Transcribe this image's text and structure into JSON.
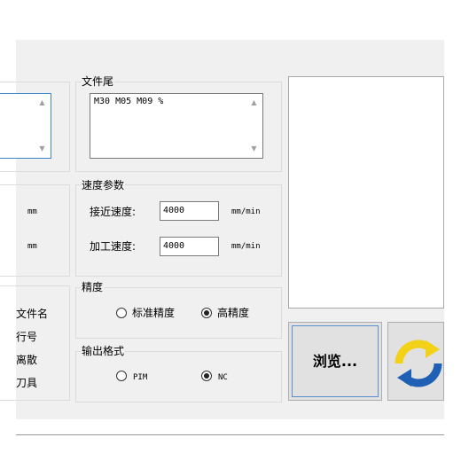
{
  "left_partial": {
    "units": [
      "mm",
      "mm"
    ],
    "options": [
      "文件名",
      "行号",
      "离散",
      "刀具"
    ]
  },
  "file_tail": {
    "legend": "文件尾",
    "content": "M30 M05 M09 %"
  },
  "speed_params": {
    "legend": "速度参数",
    "approach": {
      "label": "接近速度:",
      "value": "4000",
      "unit": "mm/min"
    },
    "machining": {
      "label": "加工速度:",
      "value": "4000",
      "unit": "mm/min"
    }
  },
  "precision": {
    "legend": "精度",
    "options": [
      {
        "label": "标准精度",
        "selected": false
      },
      {
        "label": "高精度",
        "selected": true
      }
    ]
  },
  "output_format": {
    "legend": "输出格式",
    "options": [
      {
        "label": "PIM",
        "selected": false
      },
      {
        "label": "NC",
        "selected": true
      }
    ]
  },
  "browse_button": {
    "label": "浏览..."
  },
  "refresh_button": {
    "icon": "refresh-icon"
  },
  "colors": {
    "refresh_yellow": "#f2d116",
    "refresh_blue": "#1f5fb4",
    "focus_blue": "#3f87c8"
  }
}
